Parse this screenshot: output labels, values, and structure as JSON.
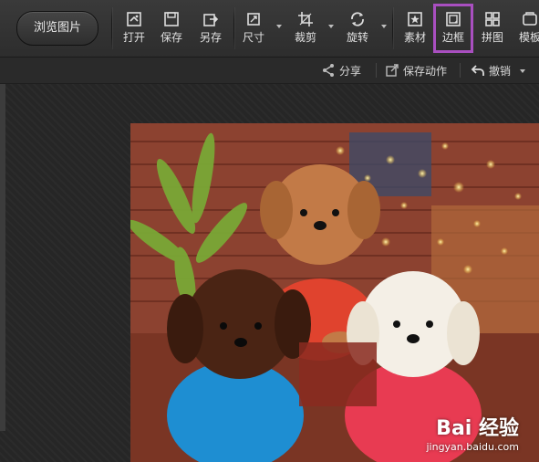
{
  "toolbar": {
    "browse_label": "浏览图片",
    "tools": [
      {
        "label": "打开",
        "icon": "open-icon"
      },
      {
        "label": "保存",
        "icon": "save-icon"
      },
      {
        "label": "另存",
        "icon": "save-as-icon"
      },
      {
        "label": "尺寸",
        "icon": "resize-icon"
      },
      {
        "label": "裁剪",
        "icon": "crop-icon"
      },
      {
        "label": "旋转",
        "icon": "rotate-icon"
      },
      {
        "label": "素材",
        "icon": "material-icon"
      },
      {
        "label": "边框",
        "icon": "border-icon",
        "selected": true
      },
      {
        "label": "拼图",
        "icon": "collage-icon"
      },
      {
        "label": "模板",
        "icon": "template-icon"
      }
    ]
  },
  "subbar": {
    "share_label": "分享",
    "save_action_label": "保存动作",
    "undo_label": "撤销"
  },
  "watermark": {
    "logo": "Bai 经验",
    "url": "jingyan.baidu.com"
  },
  "colors": {
    "highlight": "#a94fc0",
    "toolbar": "#333333",
    "canvas": "#262626"
  }
}
